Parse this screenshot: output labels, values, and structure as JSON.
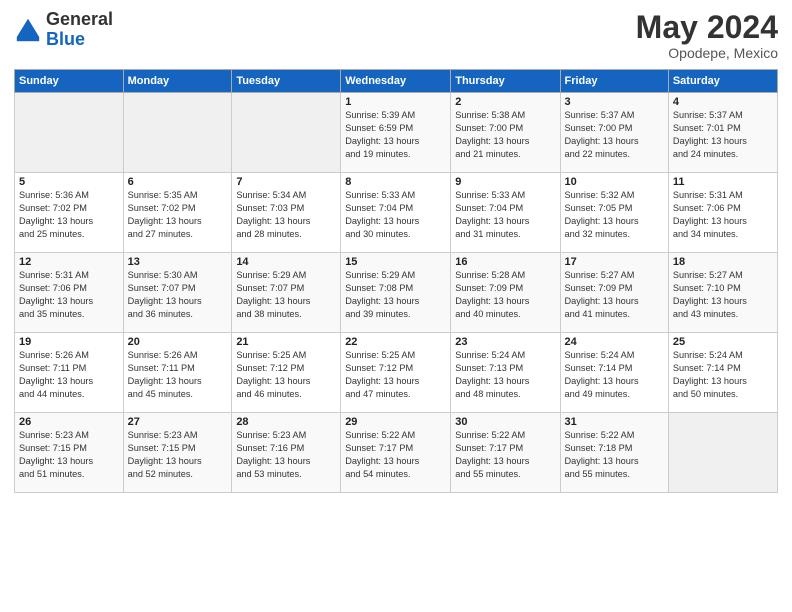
{
  "logo": {
    "text_general": "General",
    "text_blue": "Blue"
  },
  "header": {
    "month": "May 2024",
    "location": "Opodepe, Mexico"
  },
  "days_of_week": [
    "Sunday",
    "Monday",
    "Tuesday",
    "Wednesday",
    "Thursday",
    "Friday",
    "Saturday"
  ],
  "weeks": [
    [
      {
        "day": "",
        "info": ""
      },
      {
        "day": "",
        "info": ""
      },
      {
        "day": "",
        "info": ""
      },
      {
        "day": "1",
        "info": "Sunrise: 5:39 AM\nSunset: 6:59 PM\nDaylight: 13 hours\nand 19 minutes."
      },
      {
        "day": "2",
        "info": "Sunrise: 5:38 AM\nSunset: 7:00 PM\nDaylight: 13 hours\nand 21 minutes."
      },
      {
        "day": "3",
        "info": "Sunrise: 5:37 AM\nSunset: 7:00 PM\nDaylight: 13 hours\nand 22 minutes."
      },
      {
        "day": "4",
        "info": "Sunrise: 5:37 AM\nSunset: 7:01 PM\nDaylight: 13 hours\nand 24 minutes."
      }
    ],
    [
      {
        "day": "5",
        "info": "Sunrise: 5:36 AM\nSunset: 7:02 PM\nDaylight: 13 hours\nand 25 minutes."
      },
      {
        "day": "6",
        "info": "Sunrise: 5:35 AM\nSunset: 7:02 PM\nDaylight: 13 hours\nand 27 minutes."
      },
      {
        "day": "7",
        "info": "Sunrise: 5:34 AM\nSunset: 7:03 PM\nDaylight: 13 hours\nand 28 minutes."
      },
      {
        "day": "8",
        "info": "Sunrise: 5:33 AM\nSunset: 7:04 PM\nDaylight: 13 hours\nand 30 minutes."
      },
      {
        "day": "9",
        "info": "Sunrise: 5:33 AM\nSunset: 7:04 PM\nDaylight: 13 hours\nand 31 minutes."
      },
      {
        "day": "10",
        "info": "Sunrise: 5:32 AM\nSunset: 7:05 PM\nDaylight: 13 hours\nand 32 minutes."
      },
      {
        "day": "11",
        "info": "Sunrise: 5:31 AM\nSunset: 7:06 PM\nDaylight: 13 hours\nand 34 minutes."
      }
    ],
    [
      {
        "day": "12",
        "info": "Sunrise: 5:31 AM\nSunset: 7:06 PM\nDaylight: 13 hours\nand 35 minutes."
      },
      {
        "day": "13",
        "info": "Sunrise: 5:30 AM\nSunset: 7:07 PM\nDaylight: 13 hours\nand 36 minutes."
      },
      {
        "day": "14",
        "info": "Sunrise: 5:29 AM\nSunset: 7:07 PM\nDaylight: 13 hours\nand 38 minutes."
      },
      {
        "day": "15",
        "info": "Sunrise: 5:29 AM\nSunset: 7:08 PM\nDaylight: 13 hours\nand 39 minutes."
      },
      {
        "day": "16",
        "info": "Sunrise: 5:28 AM\nSunset: 7:09 PM\nDaylight: 13 hours\nand 40 minutes."
      },
      {
        "day": "17",
        "info": "Sunrise: 5:27 AM\nSunset: 7:09 PM\nDaylight: 13 hours\nand 41 minutes."
      },
      {
        "day": "18",
        "info": "Sunrise: 5:27 AM\nSunset: 7:10 PM\nDaylight: 13 hours\nand 43 minutes."
      }
    ],
    [
      {
        "day": "19",
        "info": "Sunrise: 5:26 AM\nSunset: 7:11 PM\nDaylight: 13 hours\nand 44 minutes."
      },
      {
        "day": "20",
        "info": "Sunrise: 5:26 AM\nSunset: 7:11 PM\nDaylight: 13 hours\nand 45 minutes."
      },
      {
        "day": "21",
        "info": "Sunrise: 5:25 AM\nSunset: 7:12 PM\nDaylight: 13 hours\nand 46 minutes."
      },
      {
        "day": "22",
        "info": "Sunrise: 5:25 AM\nSunset: 7:12 PM\nDaylight: 13 hours\nand 47 minutes."
      },
      {
        "day": "23",
        "info": "Sunrise: 5:24 AM\nSunset: 7:13 PM\nDaylight: 13 hours\nand 48 minutes."
      },
      {
        "day": "24",
        "info": "Sunrise: 5:24 AM\nSunset: 7:14 PM\nDaylight: 13 hours\nand 49 minutes."
      },
      {
        "day": "25",
        "info": "Sunrise: 5:24 AM\nSunset: 7:14 PM\nDaylight: 13 hours\nand 50 minutes."
      }
    ],
    [
      {
        "day": "26",
        "info": "Sunrise: 5:23 AM\nSunset: 7:15 PM\nDaylight: 13 hours\nand 51 minutes."
      },
      {
        "day": "27",
        "info": "Sunrise: 5:23 AM\nSunset: 7:15 PM\nDaylight: 13 hours\nand 52 minutes."
      },
      {
        "day": "28",
        "info": "Sunrise: 5:23 AM\nSunset: 7:16 PM\nDaylight: 13 hours\nand 53 minutes."
      },
      {
        "day": "29",
        "info": "Sunrise: 5:22 AM\nSunset: 7:17 PM\nDaylight: 13 hours\nand 54 minutes."
      },
      {
        "day": "30",
        "info": "Sunrise: 5:22 AM\nSunset: 7:17 PM\nDaylight: 13 hours\nand 55 minutes."
      },
      {
        "day": "31",
        "info": "Sunrise: 5:22 AM\nSunset: 7:18 PM\nDaylight: 13 hours\nand 55 minutes."
      },
      {
        "day": "",
        "info": ""
      }
    ]
  ]
}
